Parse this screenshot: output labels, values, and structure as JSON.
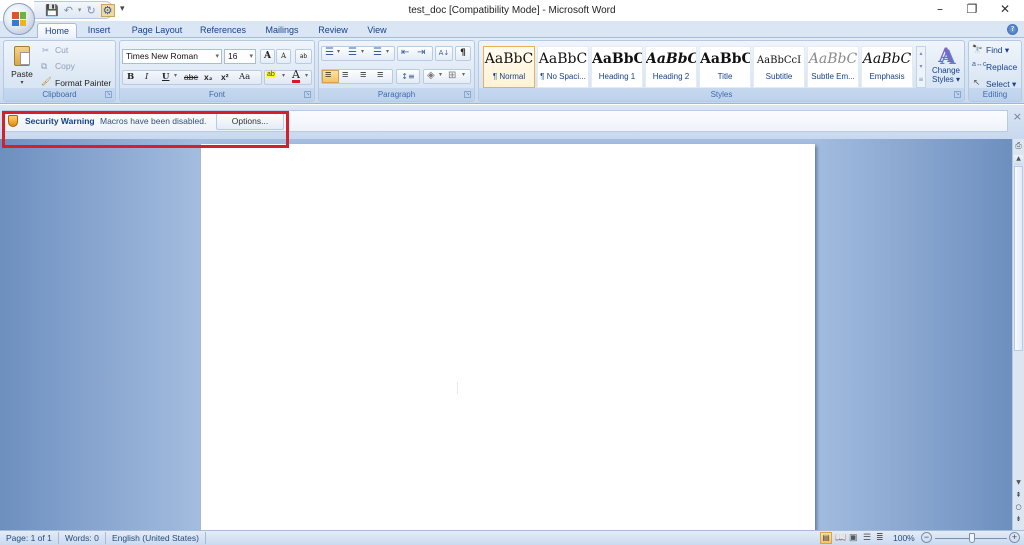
{
  "window": {
    "title": "test_doc [Compatibility Mode] - Microsoft Word",
    "minimize_icon": "minimize-icon",
    "restore_icon": "restore-icon",
    "close_icon": "close-icon"
  },
  "quick_access": {
    "items": [
      "save-icon",
      "undo-icon",
      "redo-icon",
      "macro-icon"
    ],
    "customize_label": "▾"
  },
  "tabs": [
    {
      "label": "Home",
      "active": true
    },
    {
      "label": "Insert",
      "active": false
    },
    {
      "label": "Page Layout",
      "active": false
    },
    {
      "label": "References",
      "active": false
    },
    {
      "label": "Mailings",
      "active": false
    },
    {
      "label": "Review",
      "active": false
    },
    {
      "label": "View",
      "active": false
    }
  ],
  "ribbon": {
    "clipboard": {
      "label": "Clipboard",
      "paste": "Paste",
      "cut": "Cut",
      "copy": "Copy",
      "format_painter": "Format Painter"
    },
    "font": {
      "label": "Font",
      "font_name": "Times New Roman",
      "font_size": "16",
      "grow": "A",
      "shrink": "A",
      "clear": "ab",
      "bold": "B",
      "italic": "I",
      "underline": "U",
      "strike": "abe",
      "subscript": "x₂",
      "superscript": "x²",
      "change_case": "Aa",
      "highlight": "ab",
      "font_color": "A",
      "highlight_color": "#ffff00",
      "font_color_value": "#e0161e"
    },
    "paragraph": {
      "label": "Paragraph",
      "bullets": "☰",
      "numbering": "☰",
      "multilevel": "☰",
      "decrease_indent": "⇤",
      "increase_indent": "⇥",
      "sort": "A↓",
      "show_marks": "¶",
      "align_left": "≡",
      "center": "≡",
      "align_right": "≡",
      "justify": "≡",
      "line_spacing": "↕≡",
      "shading": "◈",
      "borders": "⊞"
    },
    "styles": {
      "label": "Styles",
      "items": [
        {
          "preview": "AaBbC",
          "name": "¶ Normal",
          "selected": true
        },
        {
          "preview": "AaBbC",
          "name": "¶ No Spaci...",
          "selected": false
        },
        {
          "preview": "AaBbC",
          "name": "Heading 1",
          "selected": false
        },
        {
          "preview": "AaBbC",
          "name": "Heading 2",
          "selected": false
        },
        {
          "preview": "AaBbC",
          "name": "Title",
          "selected": false
        },
        {
          "preview": "AaBbCcI",
          "name": "Subtitle",
          "selected": false
        },
        {
          "preview": "AaBbC",
          "name": "Subtle Em...",
          "selected": false
        },
        {
          "preview": "AaBbC",
          "name": "Emphasis",
          "selected": false
        }
      ],
      "change_styles": "Change Styles ▾"
    },
    "editing": {
      "label": "Editing",
      "find": "Find ▾",
      "replace": "Replace",
      "select": "Select ▾"
    }
  },
  "security_bar": {
    "title": "Security Warning",
    "message": "Macros have been disabled.",
    "options_button": "Options...",
    "close": "×"
  },
  "statusbar": {
    "page": "Page: 1 of 1",
    "words": "Words: 0",
    "language": "English (United States)",
    "zoom": "100%",
    "zoom_level_percent": 100
  }
}
